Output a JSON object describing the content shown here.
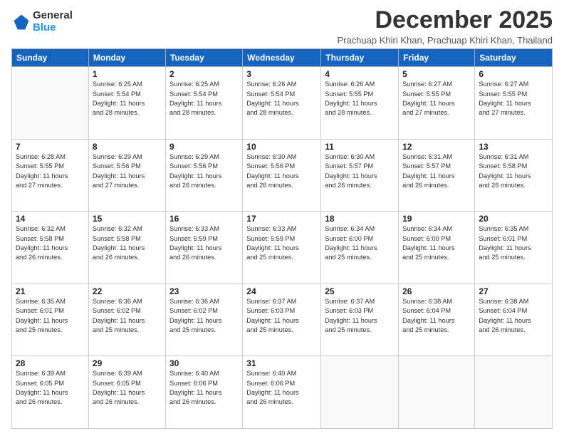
{
  "header": {
    "logo_general": "General",
    "logo_blue": "Blue",
    "month_title": "December 2025",
    "subtitle": "Prachuap Khiri Khan, Prachuap Khiri Khan, Thailand"
  },
  "weekdays": [
    "Sunday",
    "Monday",
    "Tuesday",
    "Wednesday",
    "Thursday",
    "Friday",
    "Saturday"
  ],
  "weeks": [
    [
      {
        "day": "",
        "sunrise": "",
        "sunset": "",
        "daylight": ""
      },
      {
        "day": "1",
        "sunrise": "Sunrise: 6:25 AM",
        "sunset": "Sunset: 5:54 PM",
        "daylight": "Daylight: 11 hours and 28 minutes."
      },
      {
        "day": "2",
        "sunrise": "Sunrise: 6:25 AM",
        "sunset": "Sunset: 5:54 PM",
        "daylight": "Daylight: 11 hours and 28 minutes."
      },
      {
        "day": "3",
        "sunrise": "Sunrise: 6:26 AM",
        "sunset": "Sunset: 5:54 PM",
        "daylight": "Daylight: 11 hours and 28 minutes."
      },
      {
        "day": "4",
        "sunrise": "Sunrise: 6:26 AM",
        "sunset": "Sunset: 5:55 PM",
        "daylight": "Daylight: 11 hours and 28 minutes."
      },
      {
        "day": "5",
        "sunrise": "Sunrise: 6:27 AM",
        "sunset": "Sunset: 5:55 PM",
        "daylight": "Daylight: 11 hours and 27 minutes."
      },
      {
        "day": "6",
        "sunrise": "Sunrise: 6:27 AM",
        "sunset": "Sunset: 5:55 PM",
        "daylight": "Daylight: 11 hours and 27 minutes."
      }
    ],
    [
      {
        "day": "7",
        "sunrise": "Sunrise: 6:28 AM",
        "sunset": "Sunset: 5:55 PM",
        "daylight": "Daylight: 11 hours and 27 minutes."
      },
      {
        "day": "8",
        "sunrise": "Sunrise: 6:29 AM",
        "sunset": "Sunset: 5:56 PM",
        "daylight": "Daylight: 11 hours and 27 minutes."
      },
      {
        "day": "9",
        "sunrise": "Sunrise: 6:29 AM",
        "sunset": "Sunset: 5:56 PM",
        "daylight": "Daylight: 11 hours and 26 minutes."
      },
      {
        "day": "10",
        "sunrise": "Sunrise: 6:30 AM",
        "sunset": "Sunset: 5:56 PM",
        "daylight": "Daylight: 11 hours and 26 minutes."
      },
      {
        "day": "11",
        "sunrise": "Sunrise: 6:30 AM",
        "sunset": "Sunset: 5:57 PM",
        "daylight": "Daylight: 11 hours and 26 minutes."
      },
      {
        "day": "12",
        "sunrise": "Sunrise: 6:31 AM",
        "sunset": "Sunset: 5:57 PM",
        "daylight": "Daylight: 11 hours and 26 minutes."
      },
      {
        "day": "13",
        "sunrise": "Sunrise: 6:31 AM",
        "sunset": "Sunset: 5:58 PM",
        "daylight": "Daylight: 11 hours and 26 minutes."
      }
    ],
    [
      {
        "day": "14",
        "sunrise": "Sunrise: 6:32 AM",
        "sunset": "Sunset: 5:58 PM",
        "daylight": "Daylight: 11 hours and 26 minutes."
      },
      {
        "day": "15",
        "sunrise": "Sunrise: 6:32 AM",
        "sunset": "Sunset: 5:58 PM",
        "daylight": "Daylight: 11 hours and 26 minutes."
      },
      {
        "day": "16",
        "sunrise": "Sunrise: 6:33 AM",
        "sunset": "Sunset: 5:59 PM",
        "daylight": "Daylight: 11 hours and 26 minutes."
      },
      {
        "day": "17",
        "sunrise": "Sunrise: 6:33 AM",
        "sunset": "Sunset: 5:59 PM",
        "daylight": "Daylight: 11 hours and 25 minutes."
      },
      {
        "day": "18",
        "sunrise": "Sunrise: 6:34 AM",
        "sunset": "Sunset: 6:00 PM",
        "daylight": "Daylight: 11 hours and 25 minutes."
      },
      {
        "day": "19",
        "sunrise": "Sunrise: 6:34 AM",
        "sunset": "Sunset: 6:00 PM",
        "daylight": "Daylight: 11 hours and 25 minutes."
      },
      {
        "day": "20",
        "sunrise": "Sunrise: 6:35 AM",
        "sunset": "Sunset: 6:01 PM",
        "daylight": "Daylight: 11 hours and 25 minutes."
      }
    ],
    [
      {
        "day": "21",
        "sunrise": "Sunrise: 6:35 AM",
        "sunset": "Sunset: 6:01 PM",
        "daylight": "Daylight: 11 hours and 25 minutes."
      },
      {
        "day": "22",
        "sunrise": "Sunrise: 6:36 AM",
        "sunset": "Sunset: 6:02 PM",
        "daylight": "Daylight: 11 hours and 25 minutes."
      },
      {
        "day": "23",
        "sunrise": "Sunrise: 6:36 AM",
        "sunset": "Sunset: 6:02 PM",
        "daylight": "Daylight: 11 hours and 25 minutes."
      },
      {
        "day": "24",
        "sunrise": "Sunrise: 6:37 AM",
        "sunset": "Sunset: 6:03 PM",
        "daylight": "Daylight: 11 hours and 25 minutes."
      },
      {
        "day": "25",
        "sunrise": "Sunrise: 6:37 AM",
        "sunset": "Sunset: 6:03 PM",
        "daylight": "Daylight: 11 hours and 25 minutes."
      },
      {
        "day": "26",
        "sunrise": "Sunrise: 6:38 AM",
        "sunset": "Sunset: 6:04 PM",
        "daylight": "Daylight: 11 hours and 25 minutes."
      },
      {
        "day": "27",
        "sunrise": "Sunrise: 6:38 AM",
        "sunset": "Sunset: 6:04 PM",
        "daylight": "Daylight: 11 hours and 26 minutes."
      }
    ],
    [
      {
        "day": "28",
        "sunrise": "Sunrise: 6:39 AM",
        "sunset": "Sunset: 6:05 PM",
        "daylight": "Daylight: 11 hours and 26 minutes."
      },
      {
        "day": "29",
        "sunrise": "Sunrise: 6:39 AM",
        "sunset": "Sunset: 6:05 PM",
        "daylight": "Daylight: 11 hours and 26 minutes."
      },
      {
        "day": "30",
        "sunrise": "Sunrise: 6:40 AM",
        "sunset": "Sunset: 6:06 PM",
        "daylight": "Daylight: 11 hours and 26 minutes."
      },
      {
        "day": "31",
        "sunrise": "Sunrise: 6:40 AM",
        "sunset": "Sunset: 6:06 PM",
        "daylight": "Daylight: 11 hours and 26 minutes."
      },
      {
        "day": "",
        "sunrise": "",
        "sunset": "",
        "daylight": ""
      },
      {
        "day": "",
        "sunrise": "",
        "sunset": "",
        "daylight": ""
      },
      {
        "day": "",
        "sunrise": "",
        "sunset": "",
        "daylight": ""
      }
    ]
  ]
}
